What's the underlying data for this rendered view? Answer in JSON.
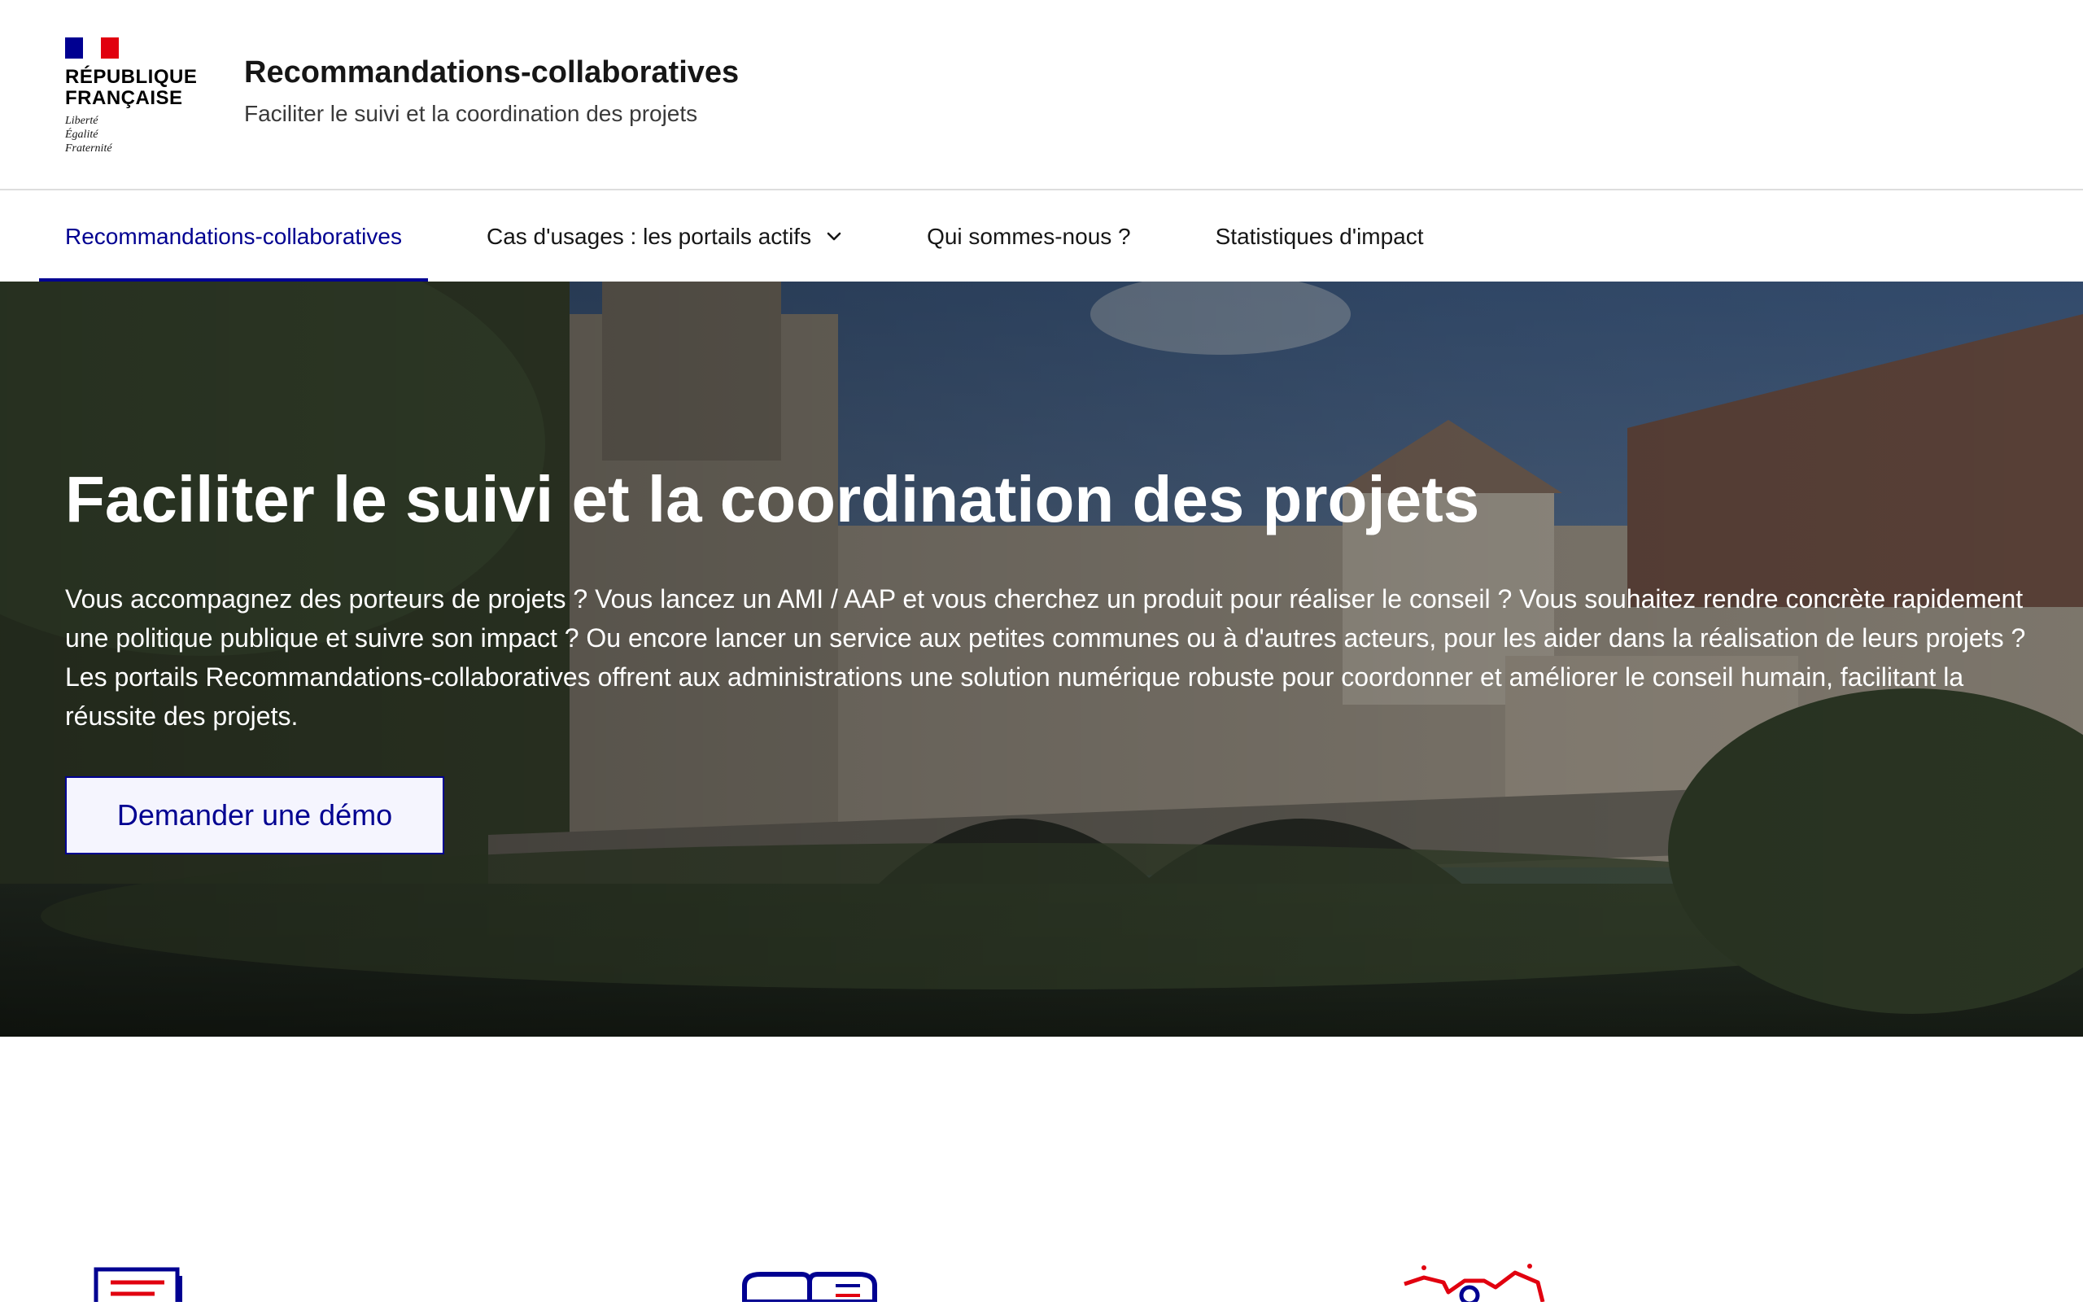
{
  "header": {
    "brand_line1": "RÉPUBLIQUE",
    "brand_line2": "FRANÇAISE",
    "motto": [
      "Liberté",
      "Égalité",
      "Fraternité"
    ],
    "service_title": "Recommandations-collaboratives",
    "service_tagline": "Faciliter le suivi et la coordination des projets"
  },
  "nav": {
    "items": [
      {
        "label": "Recommandations-collaboratives",
        "active": true
      },
      {
        "label": "Cas d'usages : les portails actifs",
        "has_dropdown": true,
        "icon": "chevron-down-icon"
      },
      {
        "label": "Qui sommes-nous ?"
      },
      {
        "label": "Statistiques d'impact"
      }
    ]
  },
  "hero": {
    "title": "Faciliter le suivi et la coordination des projets",
    "text": "Vous accompagnez des porteurs de projets ? Vous lancez un AMI / AAP et vous cherchez un produit pour réaliser le conseil ? Vous souhaitez rendre concrète rapidement une politique publique et suivre son impact ? Ou encore lancer un service aux petites communes ou à d'autres acteurs, pour les aider dans la réalisation de leurs projets ? Les portails Recommandations-collaboratives offrent aux administrations une solution numérique robuste pour coordonner et améliorer le conseil humain, facilitant la réussite des projets.",
    "cta_label": "Demander une démo"
  },
  "features": {
    "icons": [
      "document-icon",
      "book-icon",
      "map-icon"
    ]
  },
  "colors": {
    "primary": "#000091",
    "marianne_red": "#e1000f",
    "nav_border": "#dddddd",
    "button_bg": "#f5f5fe"
  }
}
